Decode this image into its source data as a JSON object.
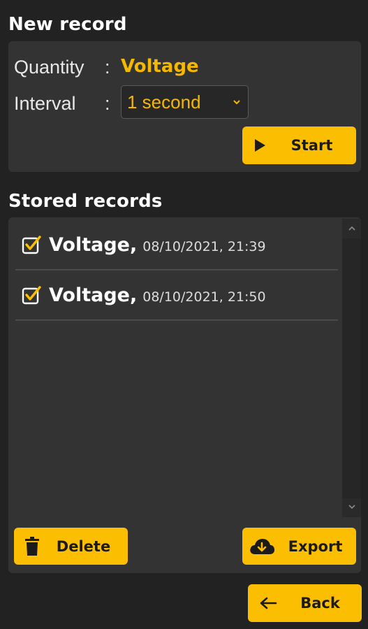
{
  "new_record": {
    "title": "New record",
    "quantity_label": "Quantity",
    "quantity_value": "Voltage",
    "interval_label": "Interval",
    "interval_value": "1 second",
    "start_label": "Start"
  },
  "stored": {
    "title": "Stored records",
    "records": [
      {
        "name": "Voltage,",
        "timestamp": "08/10/2021, 21:39",
        "checked": true
      },
      {
        "name": "Voltage,",
        "timestamp": "08/10/2021, 21:50",
        "checked": true
      }
    ],
    "delete_label": "Delete",
    "export_label": "Export"
  },
  "back_label": "Back",
  "colors": {
    "accent": "#fcbe00",
    "value_text": "#f5b800",
    "background": "#222222",
    "panel": "#333333"
  },
  "icons": [
    "play-icon",
    "chevron-down-icon",
    "checkbox-checked-icon",
    "trash-icon",
    "cloud-download-icon",
    "arrow-left-icon",
    "scroll-up-icon",
    "scroll-down-icon"
  ]
}
